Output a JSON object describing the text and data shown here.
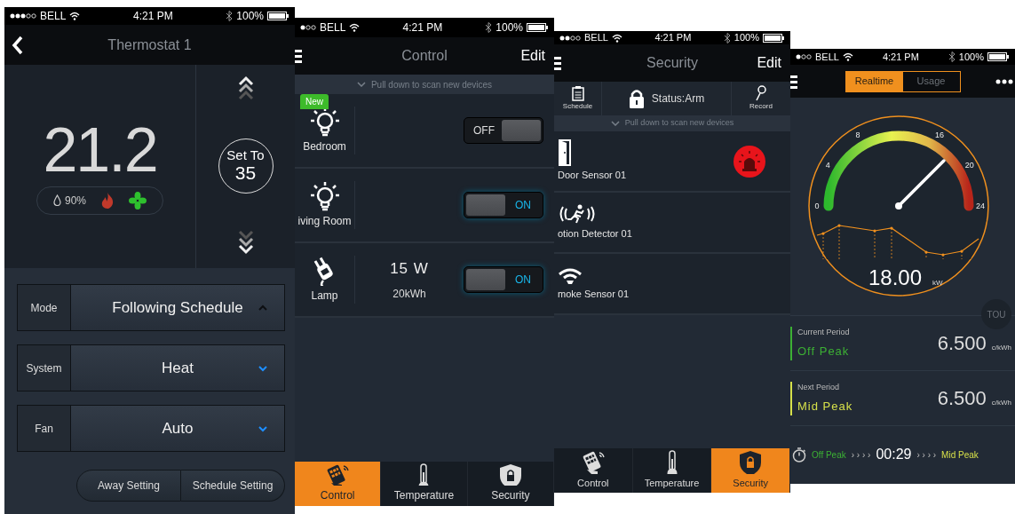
{
  "screens": [
    {
      "kind": "thermostat",
      "status_bar": {
        "carrier": "BELL",
        "time": "4:21 PM",
        "battery": "100%"
      },
      "title": "Thermostat 1",
      "temperature": "21.2",
      "humidity": "90%",
      "heating_on": true,
      "fan_on": true,
      "setpoint": {
        "label": "Set To",
        "value": "35"
      },
      "settings": [
        {
          "label": "Mode",
          "value": "Following Schedule",
          "expanded": true
        },
        {
          "label": "System",
          "value": "Heat",
          "expanded": false
        },
        {
          "label": "Fan",
          "value": "Auto",
          "expanded": false
        }
      ],
      "buttons": [
        "Away Setting",
        "Schedule Setting"
      ]
    },
    {
      "kind": "control",
      "status_bar": {
        "carrier": "BELL",
        "time": "4:21 PM",
        "battery": "100%"
      },
      "title": "Control",
      "action": "Edit",
      "hint": "Pull down to scan new devices",
      "devices": [
        {
          "kind": "light",
          "name": "Bedroom",
          "badge": "New",
          "on": false,
          "switch_label": "OFF"
        },
        {
          "kind": "light",
          "name": "iving Room",
          "on": true,
          "switch_label": "ON"
        },
        {
          "kind": "plug",
          "name": "Lamp",
          "power": "15 W",
          "energy": "20kWh",
          "on": true,
          "switch_label": "ON"
        }
      ],
      "tabs": [
        {
          "label": "Control",
          "selected": true
        },
        {
          "label": "Temperature",
          "selected": false
        },
        {
          "label": "Security",
          "selected": false
        }
      ]
    },
    {
      "kind": "security",
      "status_bar": {
        "carrier": "BELL",
        "time": "4:21 PM",
        "battery": "100%"
      },
      "title": "Security",
      "action": "Edit",
      "toolbar": {
        "schedule": "Schedule",
        "status": "Status:Arm",
        "record": "Record"
      },
      "hint": "Pull down to scan new devices",
      "devices": [
        {
          "kind": "door",
          "name": "Door Sensor 01",
          "alarm": true
        },
        {
          "kind": "motion",
          "name": "otion Detector 01",
          "alarm": false
        },
        {
          "kind": "smoke",
          "name": "moke Sensor 01",
          "alarm": false
        }
      ],
      "tabs": [
        {
          "label": "Control",
          "selected": false
        },
        {
          "label": "Temperature",
          "selected": false
        },
        {
          "label": "Security",
          "selected": true
        }
      ]
    },
    {
      "kind": "energy",
      "status_bar": {
        "carrier": "BELL",
        "time": "4:21 PM",
        "battery": "100%"
      },
      "tabs": [
        {
          "label": "Realtime",
          "selected": true
        },
        {
          "label": "Usage",
          "selected": false
        }
      ],
      "gauge": {
        "ticks": [
          "0",
          "4",
          "8",
          "16",
          "20",
          "24"
        ],
        "level": 0.75,
        "reading": "18.00",
        "unit": "kW"
      },
      "tou_badge": "TOU",
      "periods": [
        {
          "label": "Current Period",
          "name": "Off Peak",
          "color": "#3cb034",
          "price": "6.500",
          "unit": "c/kWh"
        },
        {
          "label": "Next Period",
          "name": "Mid Peak",
          "color": "#d6e04a",
          "price": "6.500",
          "unit": "c/kWh"
        }
      ],
      "countdown": {
        "from": "Off Peak",
        "arrows_before": "› › › ›",
        "time": "00:29",
        "arrows_after": "› › › ›",
        "to": "Mid Peak"
      }
    }
  ]
}
